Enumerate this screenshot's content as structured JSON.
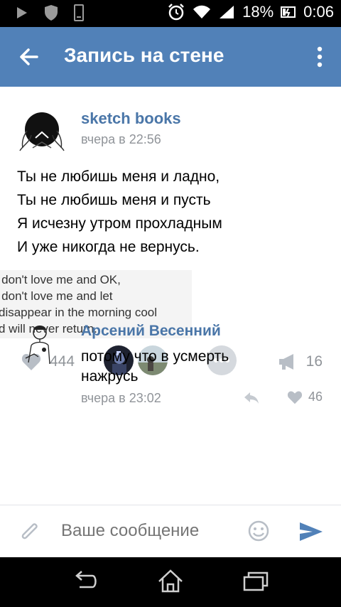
{
  "status": {
    "battery": "18%",
    "time": "0:06",
    "icons": [
      "play-icon",
      "shield-icon",
      "phone-icon",
      "alarm-icon",
      "wifi-icon",
      "signal-icon",
      "battery-icon"
    ]
  },
  "appbar": {
    "title": "Запись на стене"
  },
  "post": {
    "author": "sketch books",
    "time": "вчера в 22:56",
    "lines": [
      "Ты не любишь меня и ладно,",
      "Ты не любишь меня и пусть",
      "Я исчезну утром прохладным",
      "И уже никогда не вернусь."
    ],
    "image_lines": [
      "u don't love me and OK,",
      "u don't love me and let",
      "disappear in the morning cool",
      "d will never return."
    ],
    "likes": "444",
    "shares": "16"
  },
  "comment": {
    "author": "Арсений Весенний",
    "text_line1": "потому что в усмерть",
    "text_line2": "нажрусь",
    "time": "вчера в 23:02",
    "likes": "46"
  },
  "composer": {
    "placeholder": "Ваше сообщение"
  },
  "colors": {
    "accent": "#5181b8",
    "link": "#4a76a8",
    "muted": "#909499"
  }
}
